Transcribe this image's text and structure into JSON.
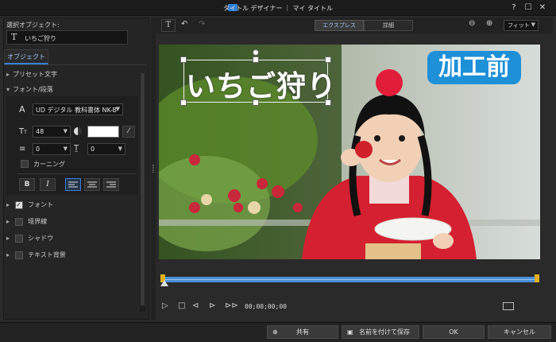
{
  "window": {
    "title": "タイトル デザイナー ｜ マイ タイトル",
    "help": "?",
    "restore": "☐",
    "close": "✕"
  },
  "left": {
    "selected_label": "選択オブジェクト:",
    "selected_icon": "T",
    "selected_value": "いちご狩り",
    "tab": "オブジェクト",
    "preset": "プリセット文字",
    "font_section": "フォント/段落",
    "font_icon": "A",
    "font_name": "UD デジタル 教科書体 NK-B",
    "size_value": "48",
    "spacing1": "0",
    "spacing2": "0",
    "kerning": "カーニング",
    "bold": "B",
    "italic": "I",
    "sections": [
      "フォント",
      "境界線",
      "シャドウ",
      "テキスト背景"
    ]
  },
  "toolbar": {
    "express": "エクスプレス",
    "detail": "詳細",
    "fit": "フィット"
  },
  "preview": {
    "title_text": "いちご狩り",
    "badge": "加工前"
  },
  "transport": {
    "timecode": "00;00;00;00"
  },
  "bottom": {
    "share": "共有",
    "save_as": "名前を付けて保存",
    "ok": "OK",
    "cancel": "キャンセル"
  },
  "colors": {
    "accent": "#3a7fd6",
    "badge_bg": "#1e90d8",
    "timeline": "#4a8fd8"
  }
}
